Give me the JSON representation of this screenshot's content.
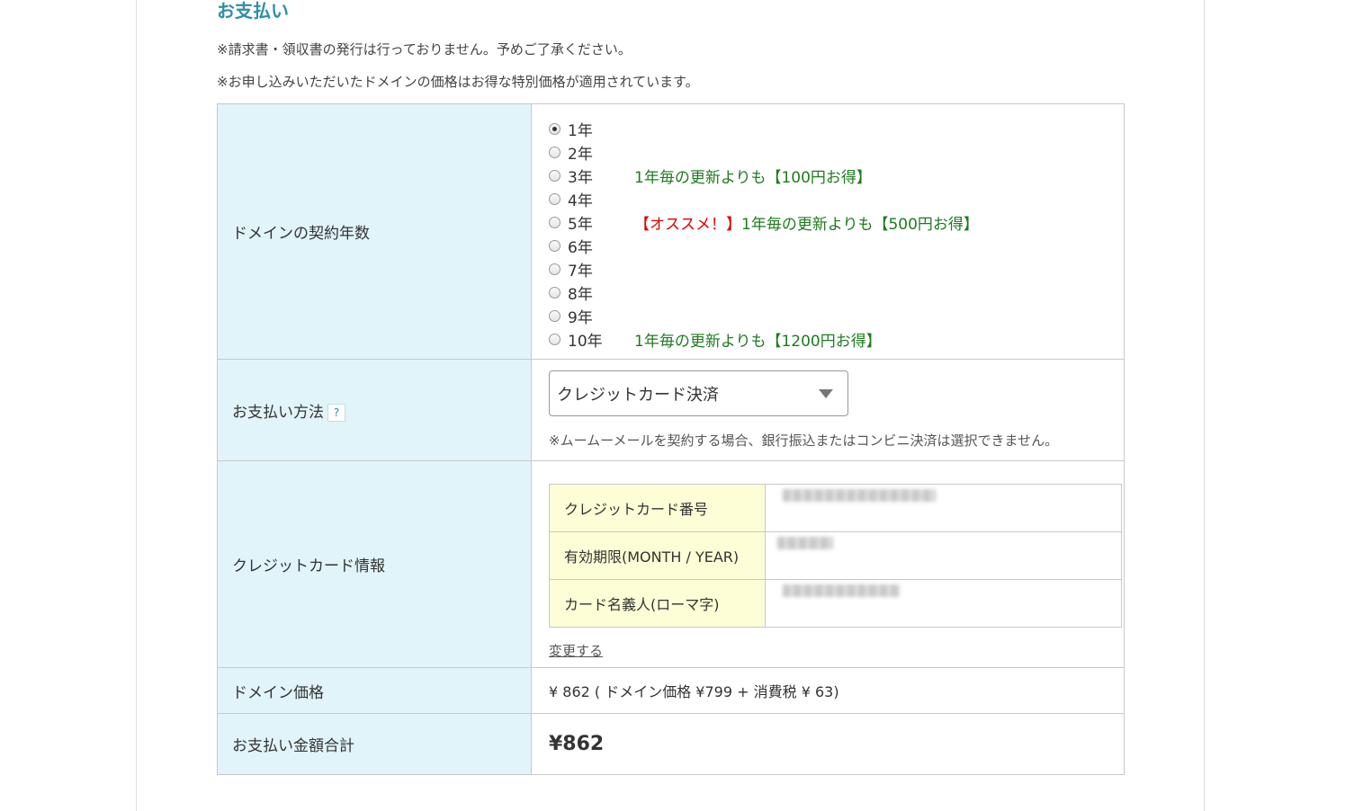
{
  "section": {
    "title": "お支払い",
    "note1": "※請求書・領収書の発行は行っておりません。予めご了承ください。",
    "note2": "※お申し込みいただいたドメインの価格はお得な特別価格が適用されています。"
  },
  "years": {
    "label": "ドメインの契約年数",
    "selected": "1年",
    "options": [
      {
        "label": "1年",
        "offer": "",
        "offer_red": ""
      },
      {
        "label": "2年",
        "offer": "",
        "offer_red": ""
      },
      {
        "label": "3年",
        "offer": "1年毎の更新よりも【100円お得】",
        "offer_red": ""
      },
      {
        "label": "4年",
        "offer": "",
        "offer_red": ""
      },
      {
        "label": "5年",
        "offer": "1年毎の更新よりも【500円お得】",
        "offer_red": "【オススメ！】"
      },
      {
        "label": "6年",
        "offer": "",
        "offer_red": ""
      },
      {
        "label": "7年",
        "offer": "",
        "offer_red": ""
      },
      {
        "label": "8年",
        "offer": "",
        "offer_red": ""
      },
      {
        "label": "9年",
        "offer": "",
        "offer_red": ""
      },
      {
        "label": "10年",
        "offer": "1年毎の更新よりも【1200円お得】",
        "offer_red": ""
      }
    ]
  },
  "payment_method": {
    "label": "お支払い方法",
    "help": "?",
    "selected": "クレジットカード決済",
    "note": "※ムームーメールを契約する場合、銀行振込またはコンビニ決済は選択できません。"
  },
  "card": {
    "label": "クレジットカード情報",
    "number_label": "クレジットカード番号",
    "expiry_label": "有効期限(MONTH / YEAR)",
    "holder_label": "カード名義人(ローマ字)",
    "change_link": "変更する"
  },
  "price": {
    "label": "ドメイン価格",
    "value": "¥ 862 ( ドメイン価格 ¥799 + 消費税 ¥ 63)"
  },
  "total": {
    "label": "お支払い金額合計",
    "value": "¥862"
  }
}
